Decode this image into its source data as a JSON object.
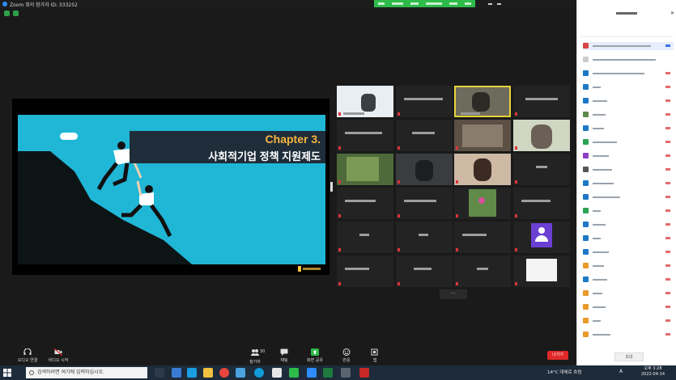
{
  "window": {
    "title": "Zoom 회의 참가자 ID: 333252"
  },
  "slide": {
    "chapter": "Chapter 3.",
    "subtitle": "사회적기업 정책 지원제도"
  },
  "toolbar": {
    "audio_label": "오디오 연결",
    "video_label": "비디오 시작",
    "participants_count": "30",
    "participants_label": "참가자",
    "chat_label": "채팅",
    "share_label": "화면 공유",
    "reactions_label": "반응",
    "apps_label": "앱",
    "leave_label": "나가기"
  },
  "participants_panel": {
    "invite_label": "초대"
  },
  "taskbar": {
    "search_placeholder": "검색하려면 여기에 입력하십시오.",
    "weather": "14°C 대체로 흐림",
    "language": "A",
    "time": "오후 3:28",
    "date": "2022-04-14"
  },
  "colors": {
    "slide_bg": "#20b6d6",
    "chapter_accent": "#f5b640",
    "leave_red": "#e02828",
    "share_green": "#2dbb4a",
    "active_speaker": "#e8d23a"
  }
}
